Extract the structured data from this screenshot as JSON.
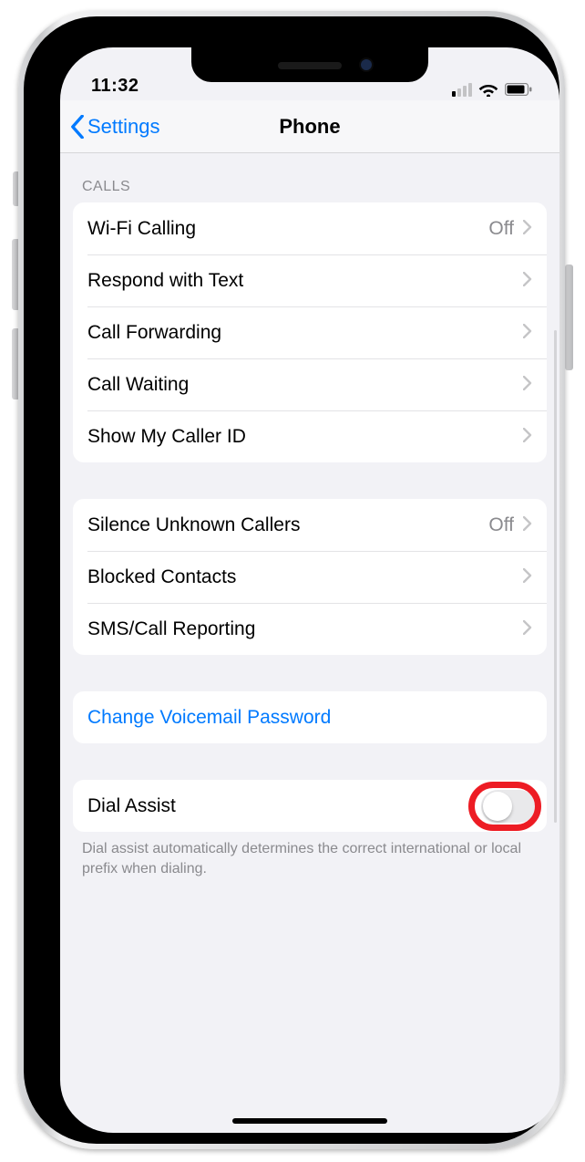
{
  "status": {
    "time": "11:32"
  },
  "nav": {
    "back_label": "Settings",
    "title": "Phone"
  },
  "section_calls": {
    "header": "CALLS",
    "rows": [
      {
        "label": "Wi-Fi Calling",
        "value": "Off"
      },
      {
        "label": "Respond with Text",
        "value": ""
      },
      {
        "label": "Call Forwarding",
        "value": ""
      },
      {
        "label": "Call Waiting",
        "value": ""
      },
      {
        "label": "Show My Caller ID",
        "value": ""
      }
    ]
  },
  "section_callers": {
    "rows": [
      {
        "label": "Silence Unknown Callers",
        "value": "Off"
      },
      {
        "label": "Blocked Contacts",
        "value": ""
      },
      {
        "label": "SMS/Call Reporting",
        "value": ""
      }
    ]
  },
  "section_voicemail": {
    "link_label": "Change Voicemail Password"
  },
  "section_dial": {
    "label": "Dial Assist",
    "footer": "Dial assist automatically determines the correct international or local prefix when dialing."
  }
}
